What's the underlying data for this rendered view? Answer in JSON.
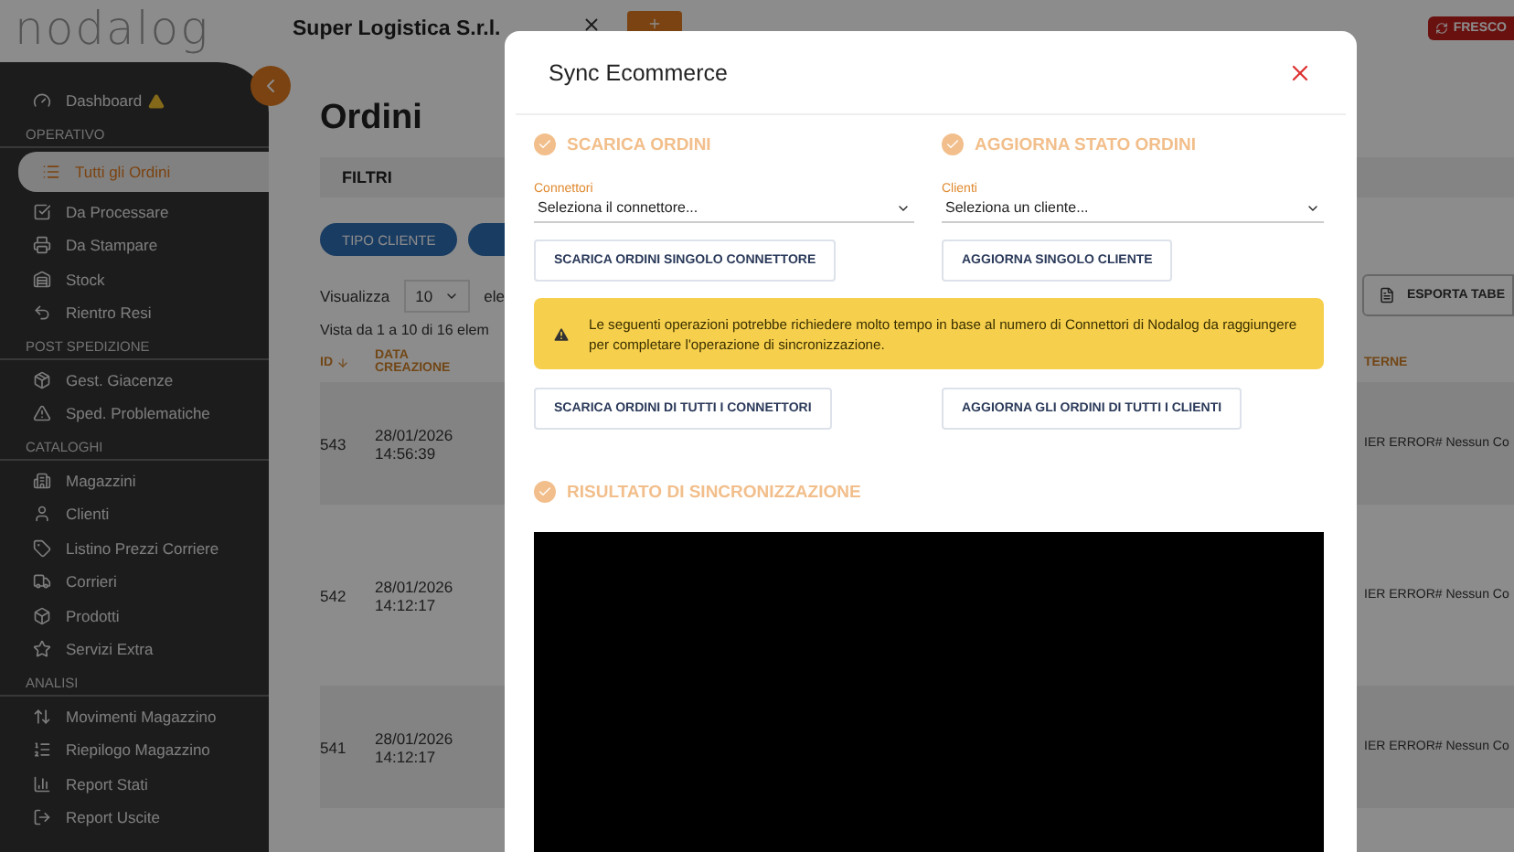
{
  "header": {
    "logo": "nodalog",
    "company": "Super Logistica S.r.l.",
    "refresh_button": "FRESCO"
  },
  "sidebar": {
    "items": [
      {
        "kind": "item",
        "label": "Dashboard",
        "alert": true,
        "selected": false
      },
      {
        "kind": "heading",
        "label": "OPERATIVO"
      },
      {
        "kind": "item",
        "label": "Tutti gli Ordini",
        "alert": false,
        "selected": true
      },
      {
        "kind": "item",
        "label": "Da Processare",
        "alert": false,
        "selected": false
      },
      {
        "kind": "item",
        "label": "Da Stampare",
        "alert": false,
        "selected": false
      },
      {
        "kind": "item",
        "label": "Stock",
        "alert": false,
        "selected": false
      },
      {
        "kind": "item",
        "label": "Rientro Resi",
        "alert": false,
        "selected": false
      },
      {
        "kind": "heading",
        "label": "POST SPEDIZIONE"
      },
      {
        "kind": "item",
        "label": "Gest. Giacenze",
        "alert": false,
        "selected": false
      },
      {
        "kind": "item",
        "label": "Sped. Problematiche",
        "alert": false,
        "selected": false
      },
      {
        "kind": "heading",
        "label": "CATALOGHI"
      },
      {
        "kind": "item",
        "label": "Magazzini",
        "alert": false,
        "selected": false
      },
      {
        "kind": "item",
        "label": "Clienti",
        "alert": false,
        "selected": false
      },
      {
        "kind": "item",
        "label": "Listino Prezzi Corriere",
        "alert": false,
        "selected": false
      },
      {
        "kind": "item",
        "label": "Corrieri",
        "alert": false,
        "selected": false
      },
      {
        "kind": "item",
        "label": "Prodotti",
        "alert": false,
        "selected": false
      },
      {
        "kind": "item",
        "label": "Servizi Extra",
        "alert": false,
        "selected": false
      },
      {
        "kind": "heading",
        "label": "ANALISI"
      },
      {
        "kind": "item",
        "label": "Movimenti Magazzino",
        "alert": false,
        "selected": false
      },
      {
        "kind": "item",
        "label": "Riepilogo Magazzino",
        "alert": false,
        "selected": false
      },
      {
        "kind": "item",
        "label": "Report Stati",
        "alert": false,
        "selected": false
      },
      {
        "kind": "item",
        "label": "Report Uscite",
        "alert": false,
        "selected": false
      }
    ]
  },
  "main": {
    "title": "Ordini",
    "filters_label": "FILTRI",
    "chips": [
      "TIPO CLIENTE"
    ],
    "page_size": {
      "label": "Visualizza",
      "value": "10",
      "suffix": "ele"
    },
    "export_button": "ESPORTA TABE",
    "summary": "Vista da 1 a 10 di 16 elem",
    "table": {
      "columns": [
        {
          "label": "ID",
          "sorted": true
        },
        {
          "label": "DATA CREAZIONE",
          "sorted": false
        },
        {
          "label": "TERNE",
          "sorted": false
        }
      ],
      "rows": [
        {
          "id": "543",
          "date": "28/01/2026",
          "time": "14:56:39",
          "note": "IER ERROR# Nessun Co"
        },
        {
          "id": "542",
          "date": "28/01/2026",
          "time": "14:12:17",
          "note": "IER ERROR# Nessun Co"
        },
        {
          "id": "541",
          "date": "28/01/2026",
          "time": "14:12:17",
          "note": "IER ERROR# Nessun Co"
        }
      ]
    }
  },
  "modal": {
    "title": "Sync Ecommerce",
    "sections": [
      {
        "title": "SCARICA ORDINI",
        "select_label": "Connettori",
        "select_value": "Seleziona il connettore...",
        "button": "SCARICA ORDINI SINGOLO CONNETTORE"
      },
      {
        "title": "AGGIORNA STATO ORDINI",
        "select_label": "Clienti",
        "select_value": "Seleziona un cliente...",
        "button": "AGGIORNA SINGOLO CLIENTE"
      }
    ],
    "warning": "Le seguenti operazioni potrebbe richiedere molto tempo in base al numero di Connettori di Nodalog da raggiungere per completare l'operazione di sincronizzazione.",
    "bulk_buttons": [
      "SCARICA ORDINI DI TUTTI I CONNETTORI",
      "AGGIORNA GLI ORDINI DI TUTTI I CLIENTI"
    ],
    "result_title": "RISULTATO DI SINCRONIZZAZIONE"
  }
}
